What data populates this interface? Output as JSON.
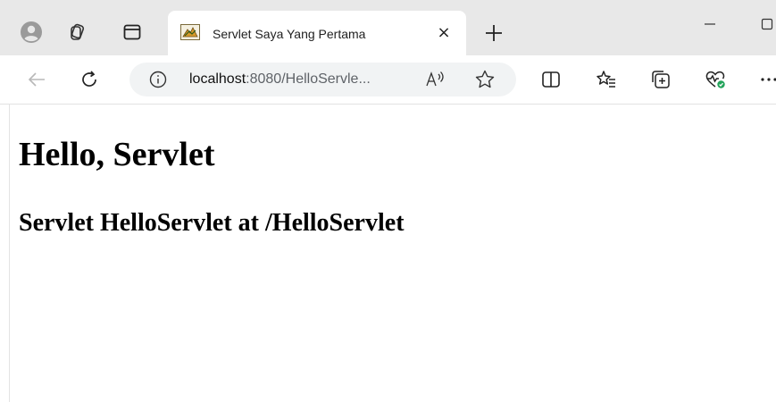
{
  "colors": {
    "tabstrip_bg": "#e8e8e8",
    "active_tab_bg": "#ffffff",
    "address_bg": "#f1f3f4",
    "health_badge": "#22a35a"
  },
  "tab": {
    "title": "Servlet Saya Yang Pertama",
    "close_glyph": "×",
    "favicon": "tomcat-icon"
  },
  "titlebar": {
    "new_tab_icon": "plus-icon",
    "minimize_icon": "minimize-icon",
    "maximize_icon": "maximize-icon"
  },
  "toolbar": {
    "url_host": "localhost",
    "url_rest": ":8080/HelloServle...",
    "read_aloud_label": "À",
    "icons": [
      "back-icon",
      "refresh-icon",
      "info-icon",
      "read-aloud-icon",
      "favorite-star-icon",
      "split-screen-icon",
      "favorites-icon",
      "collections-icon",
      "browser-essentials-icon",
      "more-icon"
    ]
  },
  "page": {
    "heading": "Hello, Servlet",
    "subheading": "Servlet HelloServlet at /HelloServlet"
  }
}
